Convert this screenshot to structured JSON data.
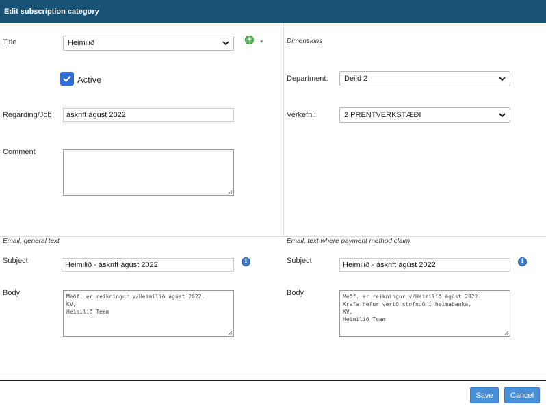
{
  "dialog": {
    "title": "Edit subscription category"
  },
  "left": {
    "title_label": "Title",
    "title_value": "Heimilið",
    "required_mark": "*",
    "active_label": "Active",
    "regarding_label": "Regarding/Job",
    "regarding_value": "áskrift ágúst 2022",
    "comment_label": "Comment",
    "comment_value": ""
  },
  "dimensions": {
    "heading": "Dimensions",
    "department_label": "Department:",
    "department_value": "Deild 2",
    "verkefni_label": "Verkefni:",
    "verkefni_value": "2 PRENTVERKSTÆÐI"
  },
  "email_general": {
    "heading": "Email, general text",
    "subject_label": "Subject",
    "subject_value": "Heimilið - áskrift ágúst 2022",
    "body_label": "Body",
    "body_value": "Meðf. er reikningur v/Heimilið ágúst 2022.\nKV,\nHeimilið Team"
  },
  "email_claim": {
    "heading": "Email, text where payment method claim",
    "subject_label": "Subject",
    "subject_value": "Heimilið - áskrift ágúst 2022",
    "body_label": "Body",
    "body_value": "Meðf. er reikningur v/Heimilið ágúst 2022.\nKrafa hefur verið stofnuð í heimabanka.\nKV,\nHeimilið Team"
  },
  "footer": {
    "save_label": "Save",
    "cancel_label": "Cancel"
  },
  "colors": {
    "header_bg": "#1a5276",
    "button_bg": "#4a90d9",
    "check_bg": "#2f6ed6",
    "add_icon": "#5cb85c",
    "info_icon": "#3b7dc4"
  },
  "icons": [
    "chevron-down-icon",
    "add-icon",
    "checkmark-icon",
    "info-icon",
    "resize-grip-icon"
  ]
}
